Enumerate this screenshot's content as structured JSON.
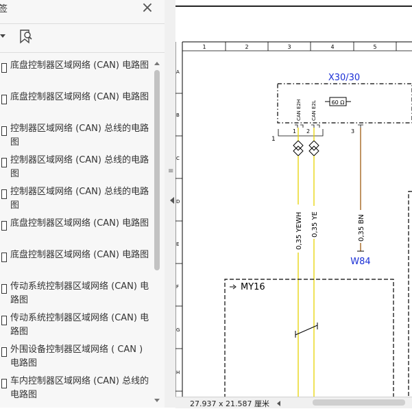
{
  "panel": {
    "title": "签",
    "close_glyph": "×",
    "bookmarks": [
      "底盘控制器区域网络 (CAN) 电路图",
      "底盘控制器区域网络 (CAN) 电路图",
      "控制器区域网络 (CAN) 总线的电路图",
      "控制器区域网络 (CAN) 总线的电路图",
      "控制器区域网络 (CAN) 总线的电路图",
      "底盘控制器区域网络 (CAN) 电路图",
      "底盘控制器区域网络 (CAN) 电路图",
      "传动系统控制器区域网络 (CAN) 电路图",
      "传动系统控制器区域网络 (CAN) 电路图",
      "外围设备控制器区域网络 ( CAN ) 电路图",
      "车内控制器区域网络 (CAN) 总线的电路图"
    ]
  },
  "schematic": {
    "columns": [
      "1",
      "2",
      "3",
      "4",
      "5"
    ],
    "rows": [
      "A",
      "B",
      "C",
      "D",
      "E",
      "F",
      "G",
      "H"
    ],
    "connector_label": "X30/30",
    "resistor_label": "60 Ω",
    "pin_a_label": "CAN E2H",
    "pin_b_label": "CAN E2L",
    "pin1": "1",
    "pin2": "2",
    "pin3": "3",
    "bus_number": "1",
    "wire1_label": "0,35 YEWH",
    "wire2_label": "0,35 YE",
    "wire3_label": "0,35 BN",
    "ground_label": "W84",
    "module_label": "MY16",
    "colors": {
      "blue_label": "#1a2fd6",
      "wire_yellow": "#e6d200",
      "wire_brown": "#b07a3c"
    }
  },
  "status": {
    "dimensions": "27.937 x 21.587 厘米"
  }
}
